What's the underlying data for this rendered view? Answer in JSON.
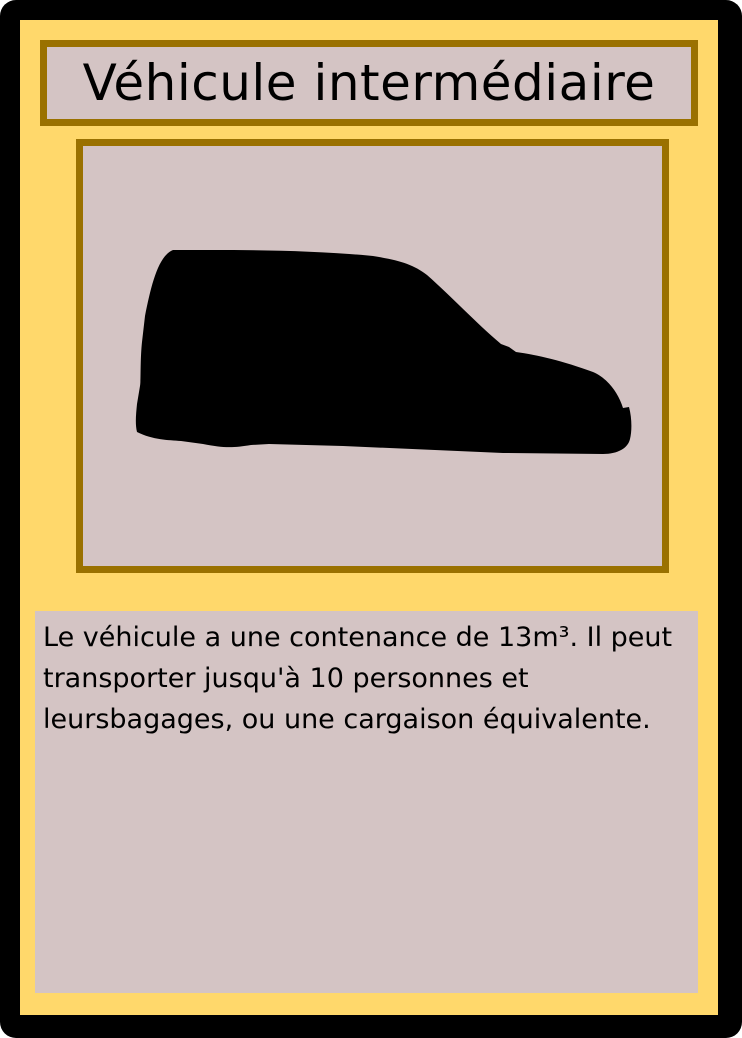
{
  "card": {
    "title": "Véhicule intermédiaire",
    "image_icon": "van-silhouette-icon",
    "description": "Le véhicule a une contenance de 13m³. Il peut transporter jusqu'à 10 personnes et leursbagages, ou une cargaison équivalente."
  },
  "colors": {
    "outer_border": "#000000",
    "card_background": "#ffd86b",
    "frame_border": "#9a7100",
    "panel_background": "#d4c4c4",
    "text": "#000000"
  }
}
